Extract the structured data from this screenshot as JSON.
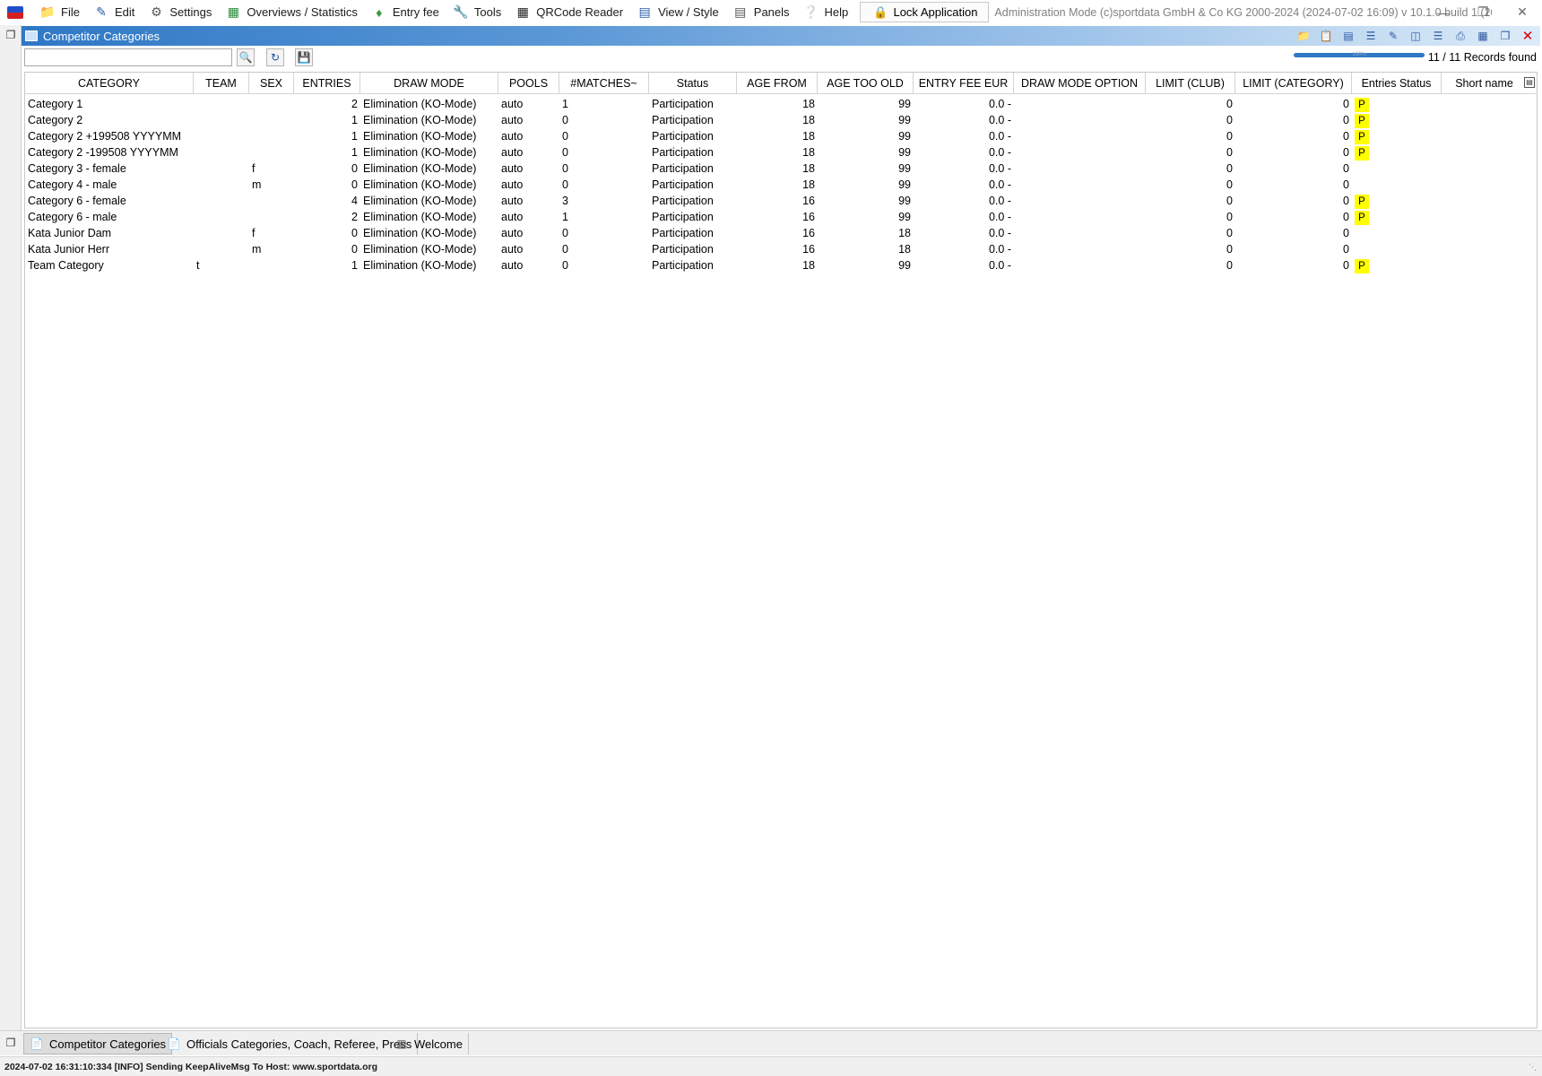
{
  "menu": {
    "items": [
      {
        "label": "File",
        "icon": "folder-icon"
      },
      {
        "label": "Edit",
        "icon": "edit-icon"
      },
      {
        "label": "Settings",
        "icon": "gear-icon"
      },
      {
        "label": "Overviews / Statistics",
        "icon": "statistics-icon"
      },
      {
        "label": "Entry fee",
        "icon": "money-icon"
      },
      {
        "label": "Tools",
        "icon": "wrench-icon"
      },
      {
        "label": "QRCode Reader",
        "icon": "qrcode-icon"
      },
      {
        "label": "View / Style",
        "icon": "view-icon"
      },
      {
        "label": "Panels",
        "icon": "panels-icon"
      },
      {
        "label": "Help",
        "icon": "help-icon"
      }
    ],
    "lock_label": "Lock Application",
    "admin_text": "Administration Mode (c)sportdata GmbH & Co KG 2000-2024 (2024-07-02 16:09)  v 10.1.0 build 1 (2024-01..."
  },
  "panel": {
    "title": "Competitor Categories",
    "search_value": "",
    "records_found": "11 / 11 Records found",
    "progress_fraction": 1.0,
    "progress_label": "100%"
  },
  "grid": {
    "columns": [
      "CATEGORY",
      "TEAM",
      "SEX",
      "ENTRIES",
      "DRAW MODE",
      "POOLS",
      "#MATCHES~",
      "Status",
      "AGE FROM",
      "AGE TOO OLD",
      "ENTRY FEE EUR",
      "DRAW MODE OPTION",
      "LIMIT (CLUB)",
      "LIMIT (CATEGORY)",
      "Entries Status",
      "Short name"
    ],
    "rows": [
      [
        "Category 1",
        "",
        "",
        "2",
        "Elimination (KO-Mode)",
        "auto",
        "1",
        "Participation",
        "18",
        "99",
        "0.0 -",
        "",
        "0",
        "0",
        "P",
        ""
      ],
      [
        "Category 2",
        "",
        "",
        "1",
        "Elimination (KO-Mode)",
        "auto",
        "0",
        "Participation",
        "18",
        "99",
        "0.0 -",
        "",
        "0",
        "0",
        "P",
        ""
      ],
      [
        "Category 2 +199508 YYYYMM",
        "",
        "",
        "1",
        "Elimination (KO-Mode)",
        "auto",
        "0",
        "Participation",
        "18",
        "99",
        "0.0 -",
        "",
        "0",
        "0",
        "P",
        ""
      ],
      [
        "Category 2 -199508 YYYYMM",
        "",
        "",
        "1",
        "Elimination (KO-Mode)",
        "auto",
        "0",
        "Participation",
        "18",
        "99",
        "0.0 -",
        "",
        "0",
        "0",
        "P",
        ""
      ],
      [
        "Category 3 - female",
        "",
        "f",
        "0",
        "Elimination (KO-Mode)",
        "auto",
        "0",
        "Participation",
        "18",
        "99",
        "0.0 -",
        "",
        "0",
        "0",
        "",
        ""
      ],
      [
        "Category 4 - male",
        "",
        "m",
        "0",
        "Elimination (KO-Mode)",
        "auto",
        "0",
        "Participation",
        "18",
        "99",
        "0.0 -",
        "",
        "0",
        "0",
        "",
        ""
      ],
      [
        "Category 6 - female",
        "",
        "",
        "4",
        "Elimination (KO-Mode)",
        "auto",
        "3",
        "Participation",
        "16",
        "99",
        "0.0 -",
        "",
        "0",
        "0",
        "P",
        ""
      ],
      [
        "Category 6 - male",
        "",
        "",
        "2",
        "Elimination (KO-Mode)",
        "auto",
        "1",
        "Participation",
        "16",
        "99",
        "0.0 -",
        "",
        "0",
        "0",
        "P",
        ""
      ],
      [
        "Kata Junior Dam",
        "",
        "f",
        "0",
        "Elimination (KO-Mode)",
        "auto",
        "0",
        "Participation",
        "16",
        "18",
        "0.0 -",
        "",
        "0",
        "0",
        "",
        ""
      ],
      [
        "Kata Junior Herr",
        "",
        "m",
        "0",
        "Elimination (KO-Mode)",
        "auto",
        "0",
        "Participation",
        "16",
        "18",
        "0.0 -",
        "",
        "0",
        "0",
        "",
        ""
      ],
      [
        "Team Category",
        "t",
        "",
        "1",
        "Elimination (KO-Mode)",
        "auto",
        "0",
        "Participation",
        "18",
        "99",
        "0.0 -",
        "",
        "0",
        "0",
        "P",
        ""
      ]
    ],
    "badge_color": "#ffff00"
  },
  "tabs": [
    {
      "label": "Competitor Categories",
      "active": true,
      "icon": "list-icon"
    },
    {
      "label": "Officials Categories, Coach, Referee, Press",
      "active": false,
      "icon": "list-icon"
    },
    {
      "label": "Welcome",
      "active": false,
      "icon": "database-icon"
    }
  ],
  "status": {
    "text": "2024-07-02 16:31:10:334 [INFO] Sending KeepAliveMsg To Host: www.sportdata.org"
  },
  "colors": {
    "title_bar_start": "#2f78c6",
    "title_bar_end": "#dcebf8",
    "accent": "#1f5bd0"
  }
}
